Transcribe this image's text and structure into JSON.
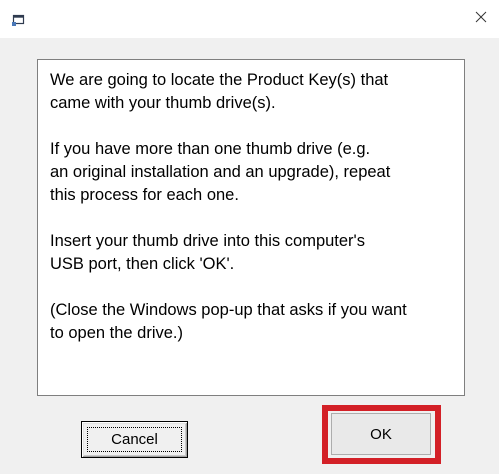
{
  "window": {
    "icon": "app-window-icon",
    "close_icon": "close-icon"
  },
  "message": {
    "paragraphs": [
      "We are going to locate the Product Key(s) that\ncame with your thumb drive(s).",
      "If you have more than one thumb drive (e.g.\nan original installation and an upgrade), repeat\nthis process for each one.",
      "Insert your thumb drive into this computer's\nUSB port, then click 'OK'.",
      "(Close the Windows pop-up that asks if you want\nto open the drive.)"
    ]
  },
  "buttons": {
    "cancel_label": "Cancel",
    "ok_label": "OK"
  },
  "highlight": {
    "color": "#d32027",
    "target": "ok-button"
  }
}
